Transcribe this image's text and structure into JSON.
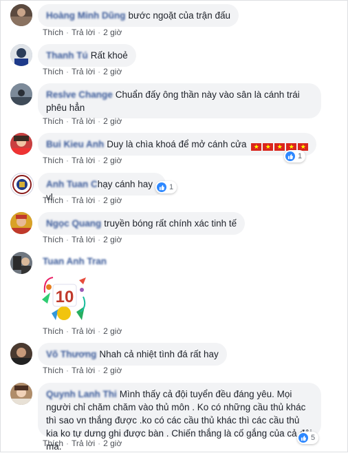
{
  "actions": {
    "like": "Thích",
    "reply": "Trả lời",
    "sep": "·",
    "time": "2 giờ"
  },
  "comments": [
    {
      "name": "Hoàng Minh Dũng",
      "text": "bước ngoặt của trận đấu"
    },
    {
      "name": "Thanh Tú",
      "text": "Rất khoẻ"
    },
    {
      "name": "Reslve Change",
      "text": "Chuẩn đấy ông thần này vào sân là cánh trái phêu hẳn"
    },
    {
      "name": "Bui Kieu Anh",
      "text": "Duy là chìa khoá để mở cánh cửa",
      "flags": [
        "★",
        "★",
        "★",
        "★",
        "★"
      ],
      "reactions": "1"
    },
    {
      "name": "Anh Tuan C",
      "text": "hạy cánh hay vl",
      "reactions": "1"
    },
    {
      "name": "Ngọc Quang",
      "text": "truyền bóng rất chính xác tinh tế"
    },
    {
      "name": "Tuan Anh Tran",
      "sticker_text": "10"
    },
    {
      "name": "Võ Thương",
      "text": "Nhah cả nhiệt tình đá rất hay"
    },
    {
      "name": "Quynh Lanh Thi",
      "text": "Mình thấy cả đội tuyển đều đáng yêu. Mọi người chỉ chăm chăm vào thủ môn . Ko có những cầu thủ khác thì sao vn thắng được .ko có các cầu thủ khác thì các cầu thủ kia ko tự dưng ghi được bàn . Chiến thắng là cố gắng của cả đội mà.",
      "reactions": "5"
    }
  ],
  "colors": {
    "name": "#385898",
    "bubble": "#f2f3f5",
    "like": "#2d88ff"
  },
  "icons": {
    "reaction": "thumbs-up-icon"
  }
}
